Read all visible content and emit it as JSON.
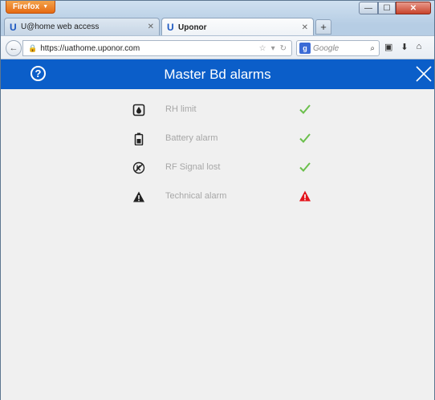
{
  "browser": {
    "menu_label": "Firefox",
    "tabs": [
      {
        "label": "U@home web access",
        "active": false
      },
      {
        "label": "Uponor",
        "active": true
      }
    ],
    "url": "https://uathome.uponor.com",
    "search_placeholder": "Google"
  },
  "page": {
    "title": "Master Bd alarms",
    "help_label": "?"
  },
  "alarms": [
    {
      "label": "RH limit",
      "icon": "humidity-icon",
      "status": "ok"
    },
    {
      "label": "Battery alarm",
      "icon": "battery-icon",
      "status": "ok"
    },
    {
      "label": "RF Signal lost",
      "icon": "rf-signal-icon",
      "status": "ok"
    },
    {
      "label": "Technical alarm",
      "icon": "warning-icon",
      "status": "alarm"
    }
  ],
  "colors": {
    "header": "#0b5ec9",
    "ok": "#6abf4b",
    "alarm": "#e3141b",
    "label": "#a7a7a7"
  }
}
